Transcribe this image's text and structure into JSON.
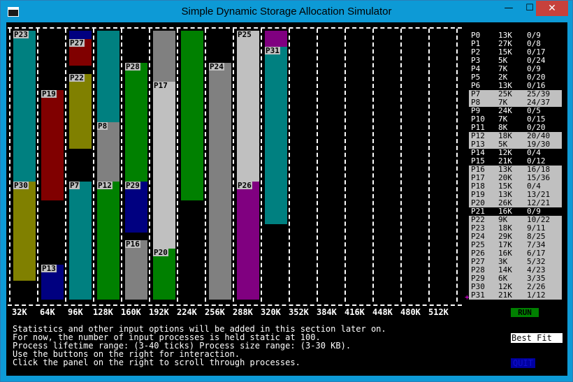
{
  "window": {
    "title": "Simple Dynamic Storage Allocation Simulator",
    "min": "—",
    "max": "☐",
    "close": "✕"
  },
  "memory_lanes": [
    {
      "blocks": [
        {
          "label": "P23",
          "color": "#008080",
          "start": 0,
          "end": 56
        },
        {
          "label": "P30",
          "color": "#808000",
          "start": 56,
          "end": 93
        }
      ]
    },
    {
      "blocks": [
        {
          "label": "P19",
          "color": "#800000",
          "start": 22,
          "end": 63
        },
        {
          "label": "P13",
          "color": "#000080",
          "start": 87,
          "end": 100
        }
      ]
    },
    {
      "blocks": [
        {
          "label": "",
          "color": "#000080",
          "start": 0,
          "end": 3
        },
        {
          "label": "P27",
          "color": "#800000",
          "start": 3,
          "end": 13
        },
        {
          "label": "P22",
          "color": "#808000",
          "start": 16,
          "end": 44
        },
        {
          "label": "P7",
          "color": "#008080",
          "start": 56,
          "end": 100
        }
      ]
    },
    {
      "blocks": [
        {
          "label": "",
          "color": "#008080",
          "start": 0,
          "end": 34
        },
        {
          "label": "P8",
          "color": "#808080",
          "start": 34,
          "end": 56
        },
        {
          "label": "P12",
          "color": "#008000",
          "start": 56,
          "end": 100
        }
      ]
    },
    {
      "blocks": [
        {
          "label": "P28",
          "color": "#008000",
          "start": 12,
          "end": 56
        },
        {
          "label": "P29",
          "color": "#000080",
          "start": 56,
          "end": 75
        },
        {
          "label": "P16",
          "color": "#808080",
          "start": 78,
          "end": 100
        }
      ]
    },
    {
      "blocks": [
        {
          "label": "",
          "color": "#808080",
          "start": 0,
          "end": 19
        },
        {
          "label": "P17",
          "color": "#c0c0c0",
          "start": 19,
          "end": 81
        },
        {
          "label": "P20",
          "color": "#008000",
          "start": 81,
          "end": 100
        }
      ]
    },
    {
      "blocks": [
        {
          "label": "",
          "color": "#008000",
          "start": 0,
          "end": 63
        }
      ]
    },
    {
      "blocks": [
        {
          "label": "P24",
          "color": "#808080",
          "start": 12,
          "end": 100
        }
      ]
    },
    {
      "blocks": [
        {
          "label": "P25",
          "color": "#c0c0c0",
          "start": 0,
          "end": 56
        },
        {
          "label": "P26",
          "color": "#800080",
          "start": 56,
          "end": 100
        }
      ]
    },
    {
      "blocks": [
        {
          "label": "",
          "color": "#800080",
          "start": 0,
          "end": 6
        },
        {
          "label": "P31",
          "color": "#008080",
          "start": 6,
          "end": 72
        }
      ]
    },
    {
      "blocks": []
    },
    {
      "blocks": []
    },
    {
      "blocks": []
    },
    {
      "blocks": []
    },
    {
      "blocks": []
    },
    {
      "blocks": []
    }
  ],
  "axis_ticks": [
    "32K",
    "64K",
    "96K",
    "128K",
    "160K",
    "192K",
    "224K",
    "256K",
    "288K",
    "320K",
    "352K",
    "384K",
    "416K",
    "448K",
    "480K",
    "512K"
  ],
  "processes": [
    {
      "id": "P0",
      "size": "13K",
      "life": "0/9",
      "active": false
    },
    {
      "id": "P1",
      "size": "27K",
      "life": "0/8",
      "active": false
    },
    {
      "id": "P2",
      "size": "15K",
      "life": "0/17",
      "active": false
    },
    {
      "id": "P3",
      "size": "5K",
      "life": "0/24",
      "active": false
    },
    {
      "id": "P4",
      "size": "7K",
      "life": "0/9",
      "active": false
    },
    {
      "id": "P5",
      "size": "2K",
      "life": "0/20",
      "active": false
    },
    {
      "id": "P6",
      "size": "13K",
      "life": "0/16",
      "active": false
    },
    {
      "id": "P7",
      "size": "25K",
      "life": "25/39",
      "active": true
    },
    {
      "id": "P8",
      "size": "7K",
      "life": "24/37",
      "active": true
    },
    {
      "id": "P9",
      "size": "24K",
      "life": "0/5",
      "active": false
    },
    {
      "id": "P10",
      "size": "7K",
      "life": "0/15",
      "active": false
    },
    {
      "id": "P11",
      "size": "8K",
      "life": "0/20",
      "active": false
    },
    {
      "id": "P12",
      "size": "18K",
      "life": "20/40",
      "active": true
    },
    {
      "id": "P13",
      "size": "5K",
      "life": "19/30",
      "active": true
    },
    {
      "id": "P14",
      "size": "12K",
      "life": "0/4",
      "active": false
    },
    {
      "id": "P15",
      "size": "21K",
      "life": "0/12",
      "active": false
    },
    {
      "id": "P16",
      "size": "13K",
      "life": "16/18",
      "active": true
    },
    {
      "id": "P17",
      "size": "20K",
      "life": "15/36",
      "active": true
    },
    {
      "id": "P18",
      "size": "15K",
      "life": "0/4",
      "active": true
    },
    {
      "id": "P19",
      "size": "13K",
      "life": "13/21",
      "active": true
    },
    {
      "id": "P20",
      "size": "26K",
      "life": "12/21",
      "active": true
    },
    {
      "id": "P21",
      "size": "16K",
      "life": "0/9",
      "active": false
    },
    {
      "id": "P22",
      "size": "9K",
      "life": "10/22",
      "active": true
    },
    {
      "id": "P23",
      "size": "18K",
      "life": "9/11",
      "active": true
    },
    {
      "id": "P24",
      "size": "29K",
      "life": "8/25",
      "active": true
    },
    {
      "id": "P25",
      "size": "17K",
      "life": "7/34",
      "active": true
    },
    {
      "id": "P26",
      "size": "16K",
      "life": "6/17",
      "active": true
    },
    {
      "id": "P27",
      "size": "3K",
      "life": "5/32",
      "active": true
    },
    {
      "id": "P28",
      "size": "14K",
      "life": "4/23",
      "active": true
    },
    {
      "id": "P29",
      "size": "6K",
      "life": "3/35",
      "active": true
    },
    {
      "id": "P30",
      "size": "12K",
      "life": "2/26",
      "active": true
    },
    {
      "id": "P31",
      "size": "21K",
      "life": "1/12",
      "active": true
    }
  ],
  "list_marker": "+",
  "info_lines": [
    "Statistics and other input options will be added in this section later on.",
    "For now, the number of input processes is held static at 100.",
    "Process lifetime range: (3-40 ticks) Process size range: (3-30 KB).",
    "Use the buttons on the right for interaction.",
    "Click the panel on the right to scroll through processes."
  ],
  "buttons": {
    "run": "RUN",
    "fit": "Best Fit",
    "quit": "QUIT"
  }
}
